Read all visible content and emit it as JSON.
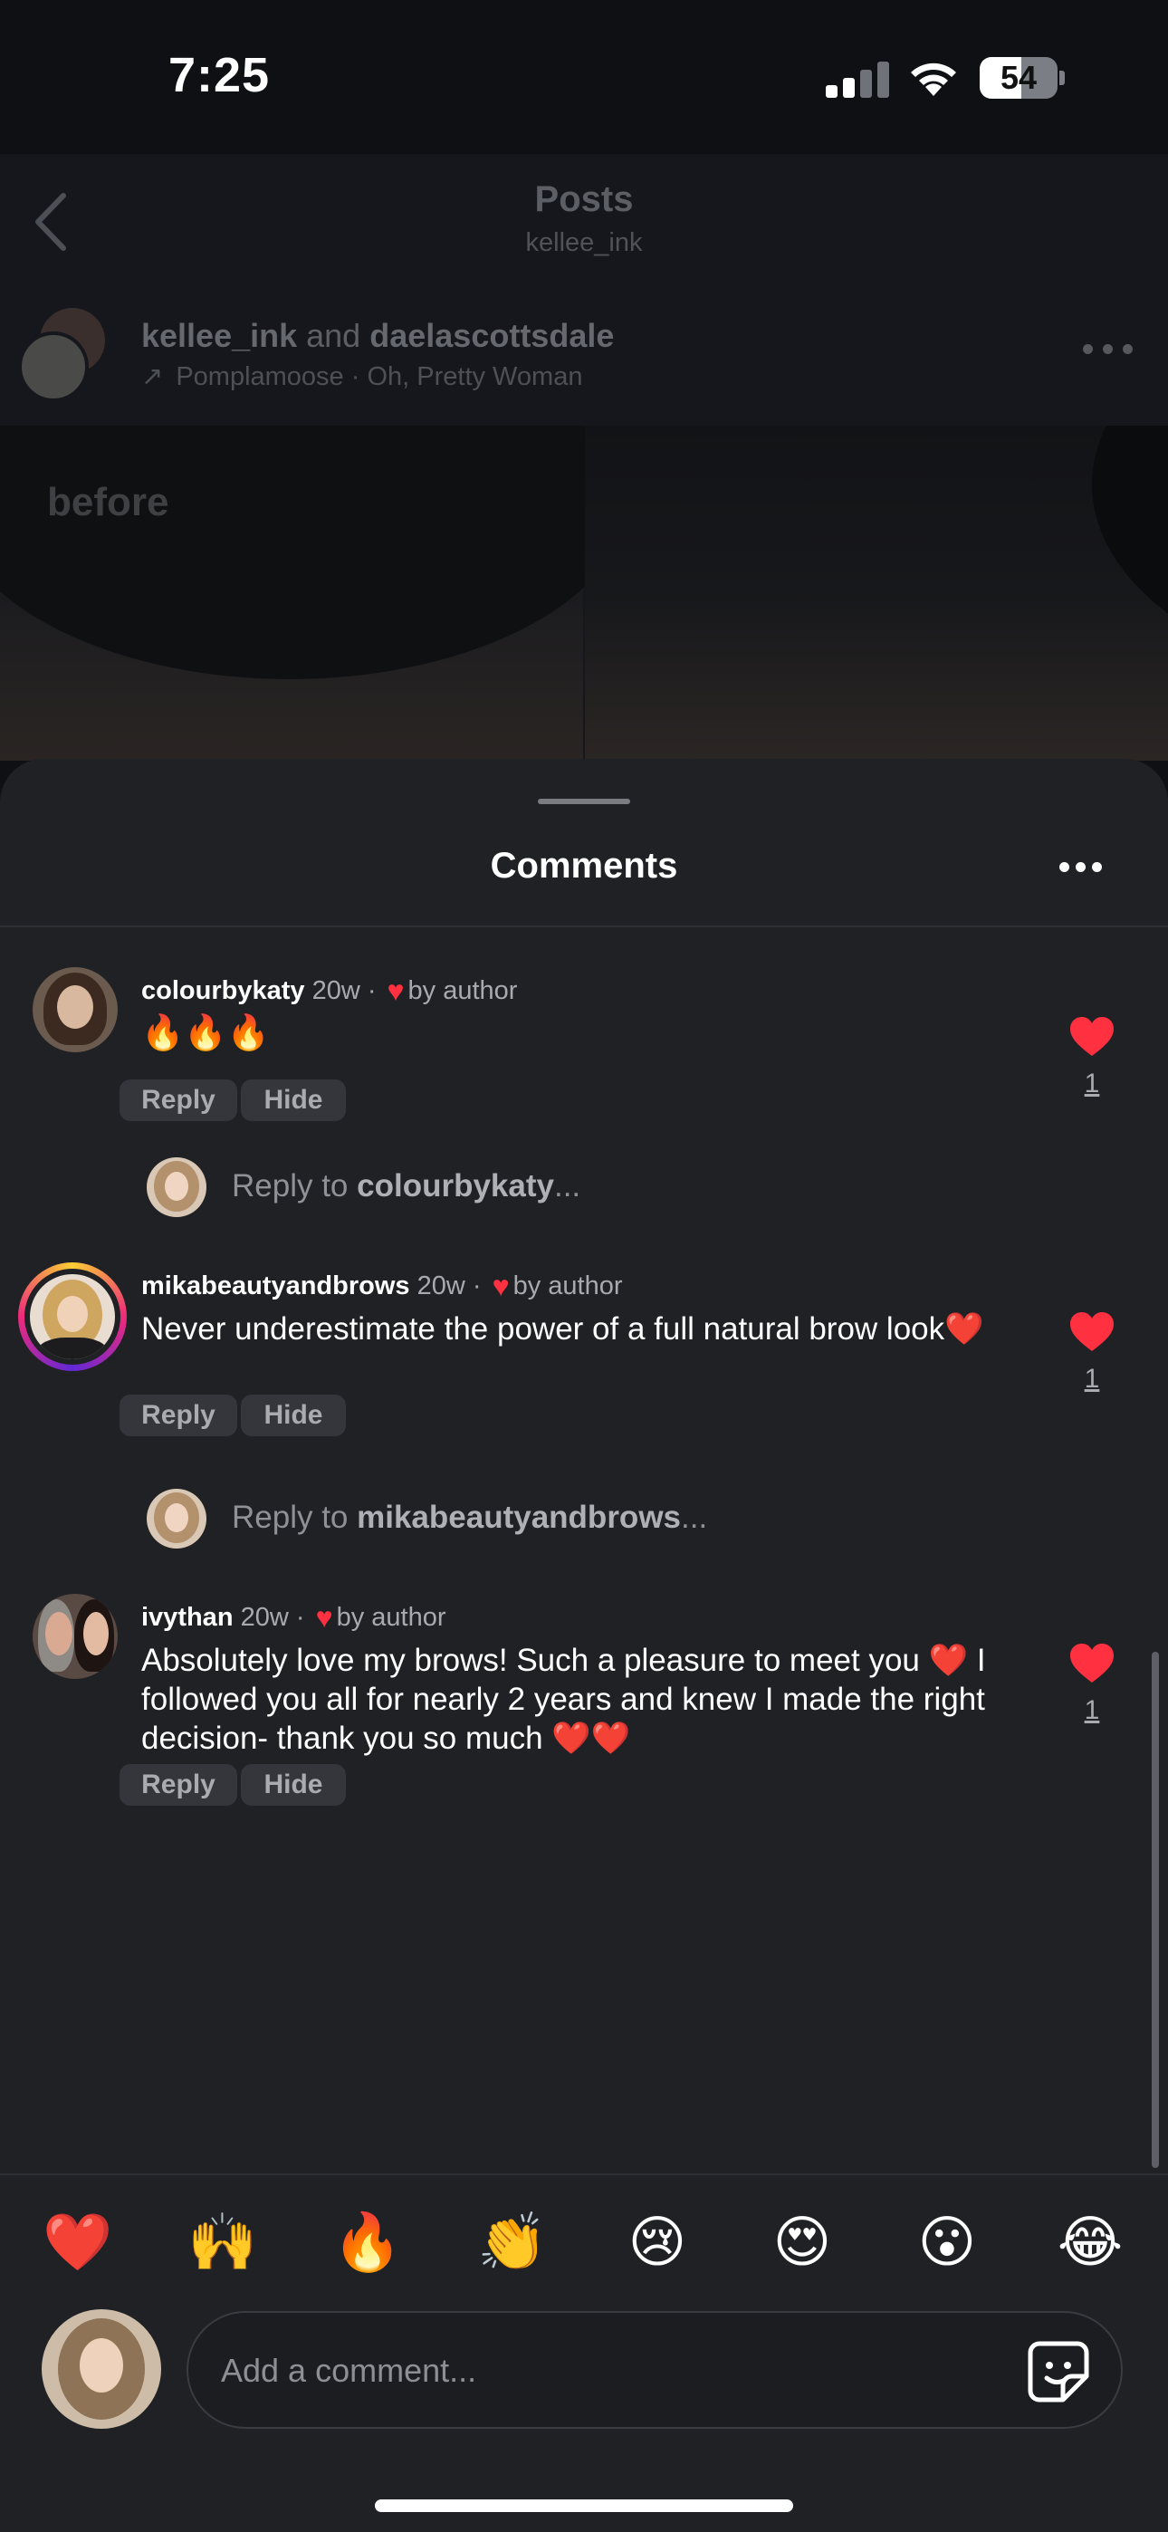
{
  "status_bar": {
    "time": "7:25",
    "battery": "54",
    "battery_level": 0.54
  },
  "nav": {
    "title": "Posts",
    "subtitle": "kellee_ink"
  },
  "post": {
    "user_1": "kellee_ink",
    "connector": "and",
    "user_2": "daelascottsdale",
    "audio": "Pomplamoose · Oh, Pretty Woman",
    "image_label": "before"
  },
  "sheet": {
    "title": "Comments"
  },
  "comments": [
    {
      "username": "colourbykaty",
      "age": "20w",
      "liked_by": "by author",
      "text": "🔥🔥🔥",
      "reply_label": "Reply",
      "hide_label": "Hide",
      "like_count": "1",
      "reply_prompt_prefix": "Reply to ",
      "reply_prompt_user": "colourbykaty",
      "reply_prompt_suffix": "..."
    },
    {
      "username": "mikabeautyandbrows",
      "age": "20w",
      "liked_by": "by author",
      "text": "Never underestimate the power of a full natural brow look❤️",
      "reply_label": "Reply",
      "hide_label": "Hide",
      "like_count": "1",
      "reply_prompt_prefix": "Reply to ",
      "reply_prompt_user": "mikabeautyandbrows",
      "reply_prompt_suffix": "..."
    },
    {
      "username": "ivythan",
      "age": "20w",
      "liked_by": "by author",
      "text": "Absolutely love my brows! Such a pleasure to meet you ❤️ I followed you all for nearly 2 years and knew I made the right decision- thank you so much ❤️❤️",
      "reply_label": "Reply",
      "hide_label": "Hide",
      "like_count": "1"
    }
  ],
  "emoji_bar": [
    "❤️",
    "🙌",
    "🔥",
    "👏",
    "😢",
    "😍",
    "😮",
    "😂"
  ],
  "composer": {
    "placeholder": "Add a comment..."
  },
  "colors": {
    "accent_red": "#ff3040",
    "sheet_bg": "#202125",
    "text_secondary": "#a8aaaf"
  }
}
